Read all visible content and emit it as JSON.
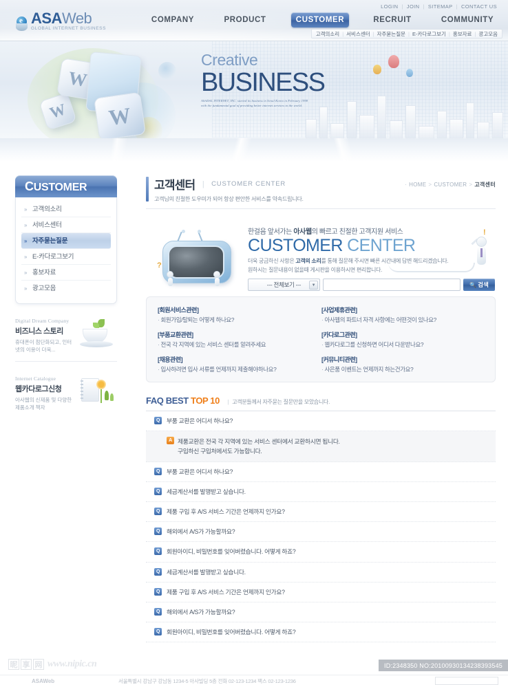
{
  "header": {
    "logo": {
      "brand_main": "ASA",
      "brand_sub": "Web",
      "tagline": "GLOBAL INTERNET BUSINESS"
    },
    "util_nav": [
      {
        "label": "LOGIN"
      },
      {
        "label": "JOIN"
      },
      {
        "label": "SITEMAP"
      },
      {
        "label": "CONTACT US"
      }
    ],
    "separator": "|",
    "main_nav": [
      {
        "label": "COMPANY",
        "active": false
      },
      {
        "label": "PRODUCT",
        "active": false
      },
      {
        "label": "CUSTOMER",
        "active": true
      },
      {
        "label": "RECRUIT",
        "active": false
      },
      {
        "label": "COMMUNITY",
        "active": false
      }
    ],
    "subnav": [
      {
        "label": "고객의소리"
      },
      {
        "label": "서비스센터"
      },
      {
        "label": "자주묻는질문"
      },
      {
        "label": "E-카다로그보기"
      },
      {
        "label": "홍보자료"
      },
      {
        "label": "광고모음"
      }
    ]
  },
  "hero": {
    "headline_light": "Creative",
    "headline_bold": "BUSINESS",
    "subline_1": "ASADAL INTERNET, INC. started its business in Seoul Korea in February 1998",
    "subline_2": "with the fundamental goal of providing better internet services to the world.",
    "cube_letters": [
      "W",
      "W",
      "W",
      "W"
    ]
  },
  "sidebar": {
    "heading_cap": "C",
    "heading_rest": "USTOMER",
    "items": [
      {
        "label": "고객의소리",
        "active": false
      },
      {
        "label": "서비스센터",
        "active": false
      },
      {
        "label": "자주묻는질문",
        "active": true
      },
      {
        "label": "E-카다로그보기",
        "active": false
      },
      {
        "label": "홍보자료",
        "active": false
      },
      {
        "label": "광고모음",
        "active": false
      }
    ],
    "arrow": "»",
    "banners": [
      {
        "eyebrow": "Digital Dream Company",
        "title": "비즈니스 스토리",
        "desc": "휴대폰이 첨단화되고,\n인터넷의 이용이 더욱..."
      },
      {
        "eyebrow": "Internet Catalogue",
        "title": "웹카다로그신청",
        "desc": "아사웹의 신제품 및\n다양한 제품소개 책자"
      }
    ]
  },
  "page_head": {
    "title": "고객센터",
    "divider": "|",
    "title_en": "CUSTOMER CENTER",
    "description": "고객님의 친절한 도우미가 되어 항상 편안한 서비스를 약속드립니다.",
    "breadcrumb": {
      "dot": "·",
      "items": [
        "HOME",
        "CUSTOMER"
      ],
      "separator": ">",
      "current": "고객센터"
    }
  },
  "cc_hero": {
    "ko_line_prefix": "한걸음 앞서가는 ",
    "ko_line_bold": "아사웹",
    "ko_line_suffix": "의 빠르고 친절한 고객지원 서비스",
    "en_word_1": "CUSTOMER",
    "en_word_2": "CENTER",
    "desc_1_pre": "더욱 궁금하신 사항은 ",
    "desc_1_bold": "고객의 소리",
    "desc_1_post": "를 통해 질문해 주시면 빠른 시간내에 답변 해드리겠습니다.",
    "desc_2": "원하시는 질문내용이 없을때 게시판을 이용하시면 편리합니다.",
    "search": {
      "select_value": "--- 전체보기 ---",
      "caret": "▼",
      "input_value": "",
      "input_placeholder": "",
      "button_label": "검색",
      "button_icon": "search-icon"
    },
    "robot_exclaim": "!",
    "tv_question": "?"
  },
  "category_box": {
    "left_column": [
      {
        "heading": "[회원서비스관련]",
        "question": "회원가입/탈퇴는 어떻게 하나요?",
        "dot": "·"
      },
      {
        "heading": "[부품교환관련]",
        "question": "전국 각 지역에 있는 서비스 센터를 알려주세요",
        "dot": "·"
      },
      {
        "heading": "[채용관련]",
        "question": "입사하려면 입사 서류를 언제까지 제출해야하나요?",
        "dot": "·"
      }
    ],
    "right_column": [
      {
        "heading": "[사업제휴관련]",
        "question": "아사웹의 파트너 자격 사항에는 어떤것이 있나요?",
        "dot": "·"
      },
      {
        "heading": "[카다로그관련]",
        "question": "웹카다로그를 신청하면 어디서 다운받나요?",
        "dot": "·"
      },
      {
        "heading": "[커뮤니티관련]",
        "question": "사은품 이벤트는 언제까지 하는건가요?",
        "dot": "·"
      }
    ]
  },
  "faq": {
    "title_1": "FAQ BEST",
    "title_2": "TOP 10",
    "note_pipe": "|",
    "note": "고객분들께서 자주묻는 질문만을 모았습니다.",
    "q_badge": "Q",
    "a_badge": "A",
    "rows": [
      {
        "type": "q",
        "text": "부품 교환은 어디서 하나요?"
      },
      {
        "type": "a",
        "text": "제품교환은 전국 각 지역에 있는 서비스 센터에서 교환하시면 됩니다.\n구입하신 구입처에서도 가능합니다."
      },
      {
        "type": "q",
        "text": "부품 교환은 어디서 하나요?"
      },
      {
        "type": "q",
        "text": "세금계산서를 발행받고 싶습니다."
      },
      {
        "type": "q",
        "text": "제품 구입 후 A/S 서비스 기간은 언제까지 인가요?"
      },
      {
        "type": "q",
        "text": "해외에서 A/S가 가능할까요?"
      },
      {
        "type": "q",
        "text": "회원아이디, 비밀번호를 잊어버렸습니다. 어떻게 하죠?"
      },
      {
        "type": "q",
        "text": "세금계산서를 발행받고 싶습니다."
      },
      {
        "type": "q",
        "text": "제품 구입 후 A/S 서비스 기간은 언제까지 인가요?"
      },
      {
        "type": "q",
        "text": "해외에서 A/S가 가능할까요?"
      },
      {
        "type": "q",
        "text": "회원아이디, 비밀번호를 잊어버렸습니다. 어떻게 하죠?"
      }
    ]
  },
  "footer": {
    "watermark_cn": [
      "昵",
      "享",
      "网"
    ],
    "watermark_url": "www.nipic.cn",
    "id_bar": "ID:2348350 NO:20100930134238393545",
    "company_text": "서울특별시 강남구 강남동 1234-5 아사빌딩 5층   전화 02-123-1234   팩스 02-123-1236",
    "company_logo": "ASAWeb"
  },
  "colors": {
    "accent_blue": "#3f6cab",
    "accent_orange": "#ef7f1a",
    "nav_active": "#4c76b5",
    "heading_navy": "#2f6aa8"
  }
}
